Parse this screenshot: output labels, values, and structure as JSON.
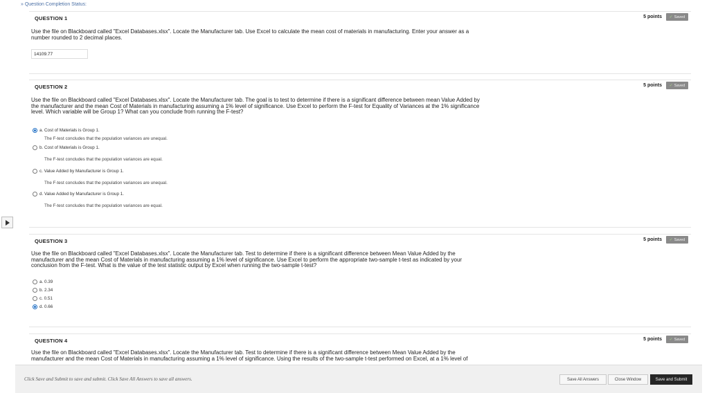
{
  "completion_status": "» Question Completion Status:",
  "questions": [
    {
      "title": "QUESTION 1",
      "points": "5 points",
      "saved": "Saved",
      "text_lines": [
        "Use the file on Blackboard called \"Excel Databases.xlsx\".  Locate the Manufacturer tab.  Use Excel to calculate the mean cost of materials in manufacturing.  Enter your answer as a",
        "number rounded to 2 decimal places."
      ],
      "answer_value": "14109.77"
    },
    {
      "title": "QUESTION 2",
      "points": "5 points",
      "saved": "Saved",
      "text_lines": [
        "Use the file on Blackboard called \"Excel Databases.xlsx\".  Locate the Manufacturer tab.  The goal is to test to determine if there is a significant difference between mean Value Added by",
        "the manufacturer and the mean Cost of Materials in manufacturing assuming a 1% level of significance.  Use Excel to perform the F-test for Equality of Variances at the 1% significance",
        "level.  Which variable will be Group 1?  What can you conclude from running the F-test?"
      ],
      "options": [
        {
          "label": "a. Cost of Materials is Group 1.",
          "detail": "The F-test concludes that the population variances are unequal.",
          "selected": true
        },
        {
          "label": "b. Cost of Materials is Group 1.",
          "detail": "The F-test concludes that the population variances are equal.",
          "selected": false
        },
        {
          "label": "c. Value Added by Manufacturer is Group 1.",
          "detail": "The F-test concludes that the population variances are unequal.",
          "selected": false
        },
        {
          "label": "d. Value Added by Manufacturer is Group 1.",
          "detail": "The F-test concludes that the population variances are equal.",
          "selected": false
        }
      ]
    },
    {
      "title": "QUESTION 3",
      "points": "5 points",
      "saved": "Saved",
      "text_lines": [
        "Use the file on Blackboard called \"Excel Databases.xlsx\".  Locate the Manufacturer tab.  Test to determine if there is a significant difference between Mean Value Added by the",
        "manufacturer and the mean Cost of Materials in manufacturing assuming a 1% level of significance.  Use Excel to perform the appropriate two-sample t-test as indicated by your",
        "conclusion from the F-test.  What is the value of the test statistic output by Excel when running the two-sample t-test?"
      ],
      "options": [
        {
          "label": "a. 0.39",
          "selected": false
        },
        {
          "label": "b. 2.34",
          "selected": false
        },
        {
          "label": "c. 0.51",
          "selected": false
        },
        {
          "label": "d. 0.66",
          "selected": true
        }
      ]
    },
    {
      "title": "QUESTION 4",
      "points": "5 points",
      "saved": "Saved",
      "text_lines": [
        "Use the file on Blackboard called \"Excel Databases.xlsx\".  Locate the Manufacturer tab.  Test to determine if there is a significant difference between Mean Value Added by the",
        "manufacturer and the mean Cost of Materials in manufacturing assuming a 1% level of significance.  Using the results of the two-sample t-test performed on Excel, at a 1% level of"
      ]
    }
  ],
  "footer": {
    "hint": "Click Save and Submit to save and submit. Click Save All Answers to save all answers.",
    "save_all": "Save All Answers",
    "close_window": "Close Window",
    "save_submit": "Save and Submit"
  }
}
